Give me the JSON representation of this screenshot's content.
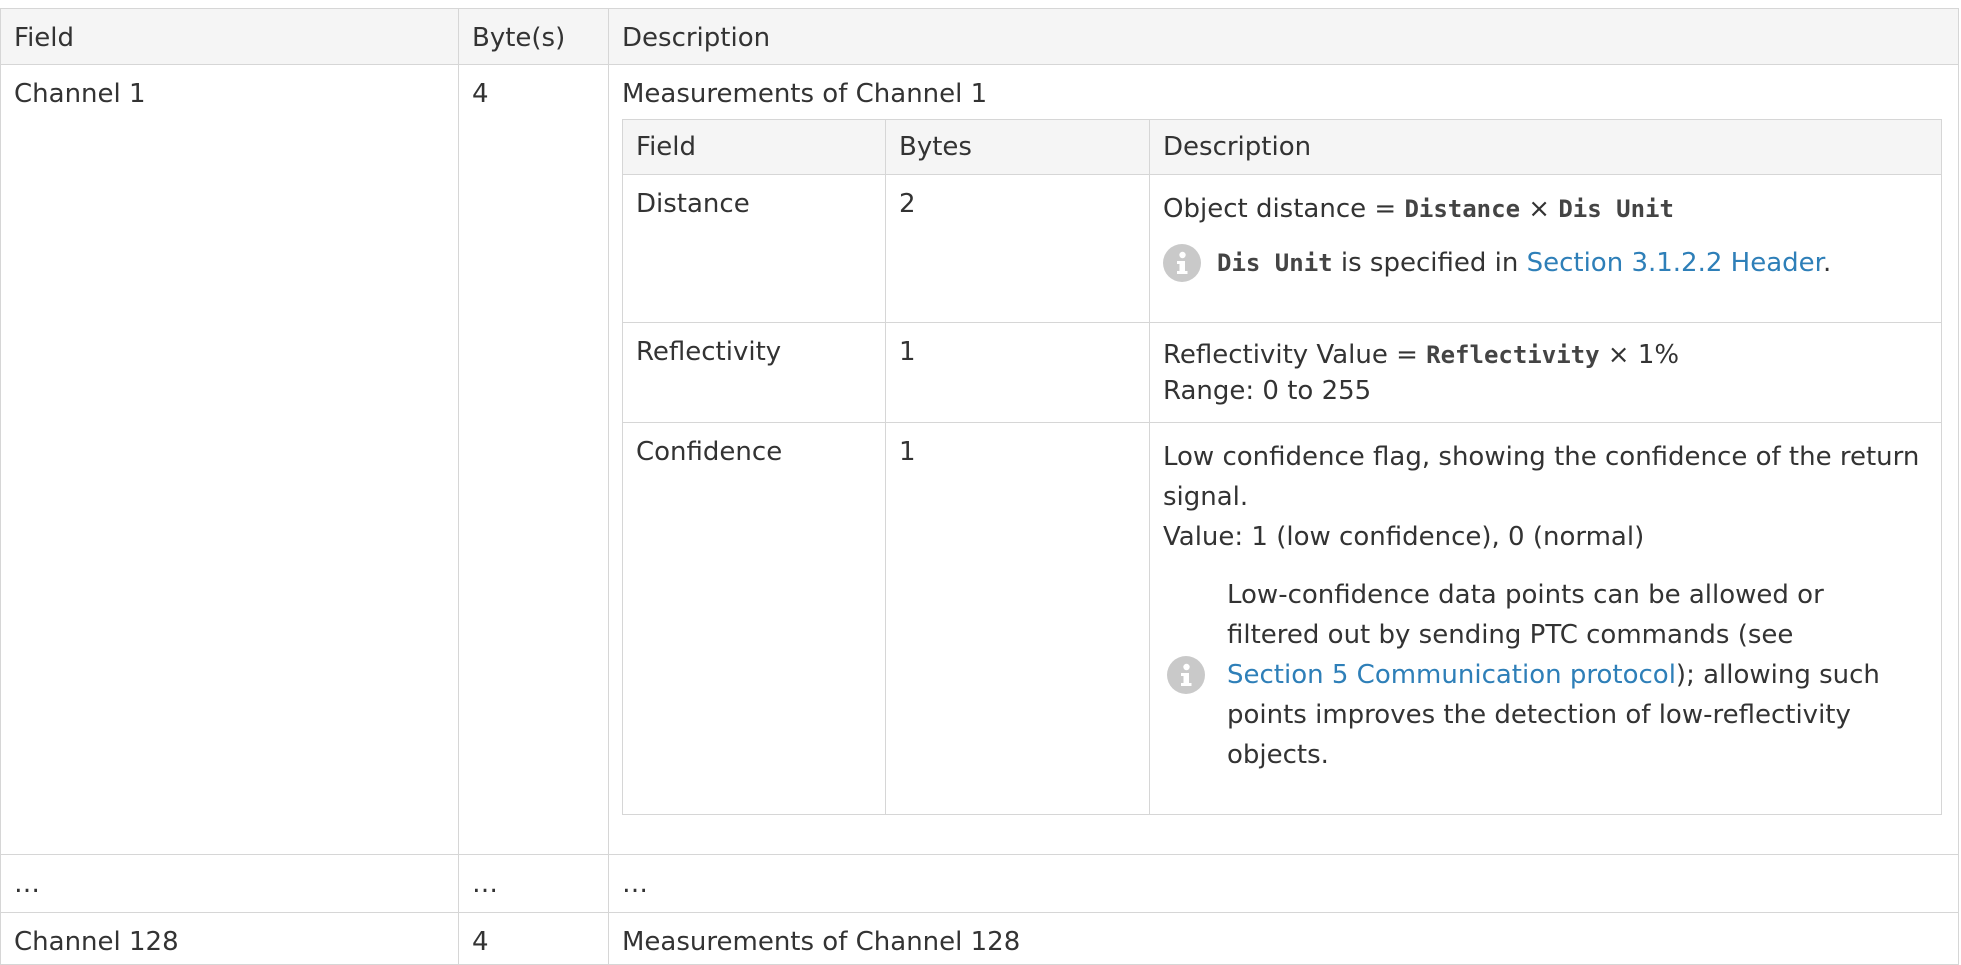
{
  "outer": {
    "headers": [
      "Field",
      "Byte(s)",
      "Description"
    ],
    "rows": [
      {
        "field": "Channel 1",
        "bytes": "4",
        "description": "Measurements of Channel 1"
      },
      {
        "field": "…",
        "bytes": "…",
        "description": "…"
      },
      {
        "field": "Channel 128",
        "bytes": "4",
        "description": "Measurements of Channel 128"
      }
    ]
  },
  "inner": {
    "headers": [
      "Field",
      "Bytes",
      "Description"
    ],
    "distance": {
      "field": "Distance",
      "bytes": "2",
      "desc_prefix": "Object distance = ",
      "desc_code1": "Distance",
      "desc_times": " × ",
      "desc_code2": "Dis Unit",
      "note_code": "Dis Unit",
      "note_mid": " is specified in ",
      "note_link": "Section 3.1.2.2 Header",
      "note_end": "."
    },
    "reflectivity": {
      "field": "Reflectivity",
      "bytes": "1",
      "desc_prefix": "Reflectivity Value = ",
      "desc_code": "Reflectivity",
      "desc_suffix": " × 1%",
      "range": "Range: 0 to 255"
    },
    "confidence": {
      "field": "Confidence",
      "bytes": "1",
      "desc_line1": "Low confidence flag, showing the confidence of the return",
      "desc_line2": "signal.",
      "value": "Value: 1 (low confidence), 0 (normal)",
      "note_line1": "Low-confidence data points can be allowed or",
      "note_line2": "filtered out by sending PTC commands (see",
      "note_link": "Section 5 Communication protocol",
      "note_after_link": "); allowing such",
      "note_line4": "points improves the detection of low-reflectivity",
      "note_line5": "objects."
    }
  },
  "icons": {
    "note": "info-icon"
  },
  "colors": {
    "link": "#2e7fb8",
    "border": "#d6d6d6",
    "header_bg": "#f5f5f5",
    "icon_bg": "#c9c9c9"
  }
}
